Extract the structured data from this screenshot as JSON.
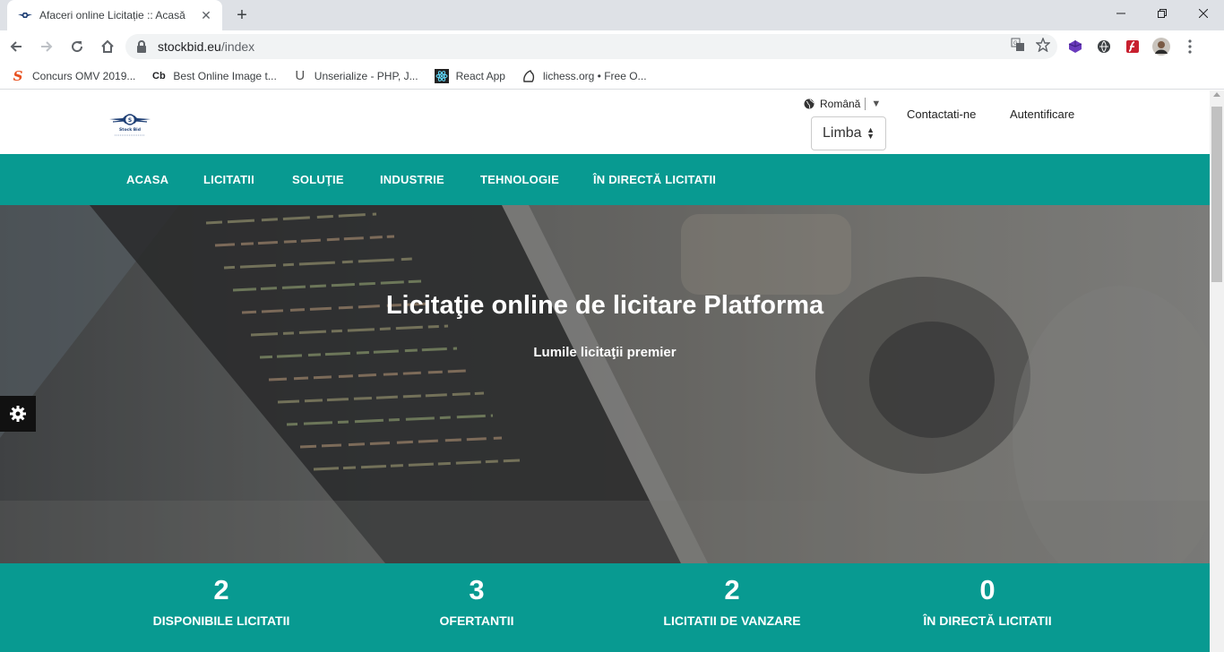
{
  "browser": {
    "tab_title": "Afaceri online Licitație :: Acasă",
    "url_host": "stockbid.eu",
    "url_path": "/index",
    "bookmarks": [
      {
        "label": "Concurs OMV 2019...",
        "icon": "S"
      },
      {
        "label": "Best Online Image t...",
        "icon": "Cb"
      },
      {
        "label": "Unserialize - PHP, J...",
        "icon": "U"
      },
      {
        "label": "React App",
        "icon": "react"
      },
      {
        "label": "lichess.org • Free O...",
        "icon": "lichess"
      }
    ]
  },
  "site": {
    "logo_text": "Stock Bid",
    "language": {
      "current": "Română",
      "select_label": "Limba"
    },
    "header_links": {
      "contact": "Contactati-ne",
      "login": "Autentificare"
    },
    "nav": [
      "ACASA",
      "LICITATII",
      "SOLUŢIE",
      "INDUSTRIE",
      "TEHNOLOGIE",
      "ÎN DIRECTĂ LICITATII"
    ],
    "hero": {
      "title": "Licitaţie online de licitare Platforma",
      "subtitle": "Lumile licitaţii premier"
    },
    "stats": [
      {
        "value": "2",
        "label": "DISPONIBILE LICITATII"
      },
      {
        "value": "3",
        "label": "OFERTANTII"
      },
      {
        "value": "2",
        "label": "LICITATII DE VANZARE"
      },
      {
        "value": "0",
        "label": "ÎN DIRECTĂ LICITATII"
      }
    ],
    "colors": {
      "accent": "#089a91",
      "settings_tab": "#111111"
    }
  }
}
